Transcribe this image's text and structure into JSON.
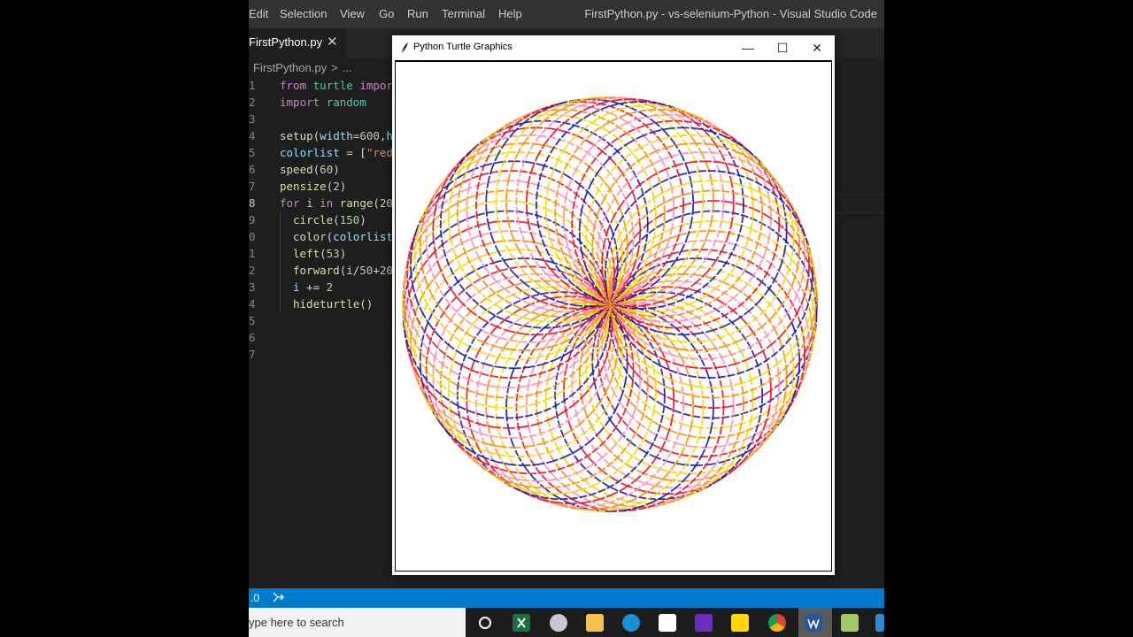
{
  "menubar": {
    "items": [
      "Edit",
      "Selection",
      "View",
      "Go",
      "Run",
      "Terminal",
      "Help"
    ],
    "window_title": "FirstPython.py - vs-selenium-Python - Visual Studio Code"
  },
  "tab": {
    "label": "FirstPython.py",
    "close_glyph": "✕"
  },
  "breadcrumb": {
    "file": "FirstPython.py",
    "sep": ">",
    "rest": "..."
  },
  "gutter": [
    "1",
    "2",
    "3",
    "4",
    "5",
    "6",
    "7",
    "8",
    "9",
    "0",
    "1",
    "2",
    "3",
    "4",
    "5",
    "6",
    "7"
  ],
  "active_line_index": 7,
  "code": {
    "l1_kw": "from",
    "l1_mod": "turtle",
    "l1_kw2": "import",
    "l2_kw": "import",
    "l2_mod": "random",
    "l4_fn": "setup",
    "l4_open": "(",
    "l4_var": "width",
    "l4_eq": "=",
    "l4_num": "600",
    "l4_rest": ",h",
    "l5_var": "colorlist",
    "l5_eq": " = [",
    "l5_str": "\"red",
    "l6_fn": "speed",
    "l6_open": "(",
    "l6_num": "60",
    "l6_close": ")",
    "l7_fn": "pensize",
    "l7_open": "(",
    "l7_num": "2",
    "l7_close": ")",
    "l8_kw": "for",
    "l8_var": " i ",
    "l8_kw2": "in",
    "l8_fn": " range",
    "l8_open": "(",
    "l8_num": "20",
    "l9_fn": "circle",
    "l9_open": "(",
    "l9_num": "150",
    "l9_close": ")",
    "l10_fn": "color",
    "l10_open": "(",
    "l10_var": "colorlist",
    "l11_fn": "left",
    "l11_open": "(",
    "l11_num": "53",
    "l11_close": ")",
    "l12_fn": "forward",
    "l12_open": "(",
    "l12_var": "i",
    "l12_op": "/",
    "l12_num": "50",
    "l12_plus": "+",
    "l12_num2": "20",
    "l13_var": "i",
    "l13_op": " += ",
    "l13_num": "2",
    "l14_fn": "hideturtle",
    "l14_rest": "()"
  },
  "statusbar": {
    "text": ".0",
    "icon": "live-share-icon"
  },
  "taskbar": {
    "search_placeholder": "ype here to search",
    "icons": [
      "cortana-icon",
      "excel-icon",
      "snipping-icon",
      "file-explorer-icon",
      "edge-icon",
      "notepad-icon",
      "visual-studio-icon",
      "sticky-notes-icon",
      "chrome-icon",
      "word-icon",
      "notepadpp-icon",
      "vscode-icon"
    ]
  },
  "turtle_window": {
    "title": "Python Turtle Graphics",
    "minimize": "—",
    "maximize": "☐",
    "close": "✕"
  },
  "drawing": {
    "colors": [
      "red",
      "blue",
      "yellow",
      "orange",
      "pink"
    ],
    "circle_radius": 150,
    "turn_degrees": 53,
    "speed": 60,
    "pensize": 2
  }
}
